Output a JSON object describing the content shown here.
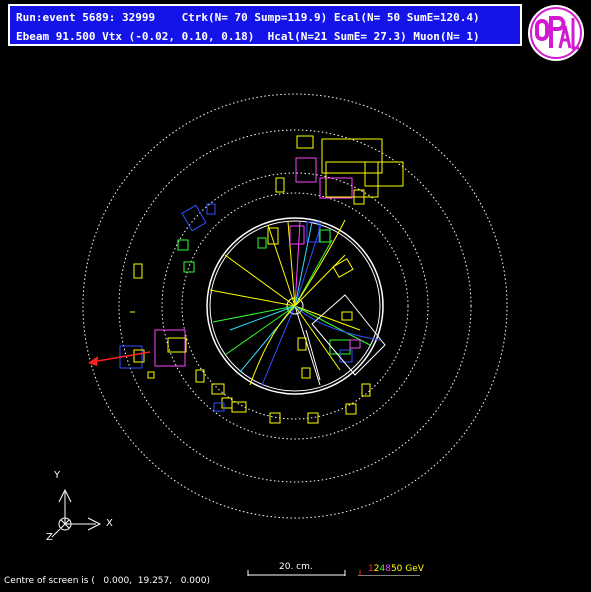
{
  "header": {
    "line1": "Run:event 5689: 32999    Ctrk(N= 70 Sump=119.9) Ecal(N= 50 SumE=120.4)",
    "line2": "Ebeam 91.500 Vtx (-0.02, 0.10, 0.18)  Hcal(N=21 SumE= 27.3) Muon(N= 1)"
  },
  "logo": {
    "text": "OPAL",
    "color": "#d21ad2"
  },
  "axes": {
    "x": "X",
    "y": "Y",
    "z": "Z"
  },
  "scale": {
    "label": "20. cm."
  },
  "energy_scale": {
    "digits": [
      {
        "text": "1",
        "color": "#ff3030"
      },
      {
        "text": "2",
        "color": "#ffff00"
      },
      {
        "text": "4",
        "color": "#30ff30"
      },
      {
        "text": "8",
        "color": "#ff40ff"
      },
      {
        "text": "50 GeV",
        "color": "#ffff00"
      }
    ]
  },
  "footer": {
    "text": "Centre of screen is (   0.000,  19.257,   0.000)"
  },
  "colors": {
    "background": "#000000",
    "header_bg": "#1414e8",
    "track_yellow": "#ffff00",
    "track_green": "#30ff30",
    "track_blue": "#3050ff",
    "track_cyan": "#30e0ff",
    "calo_magenta": "#ff40ff",
    "muon_red": "#ff2020"
  }
}
